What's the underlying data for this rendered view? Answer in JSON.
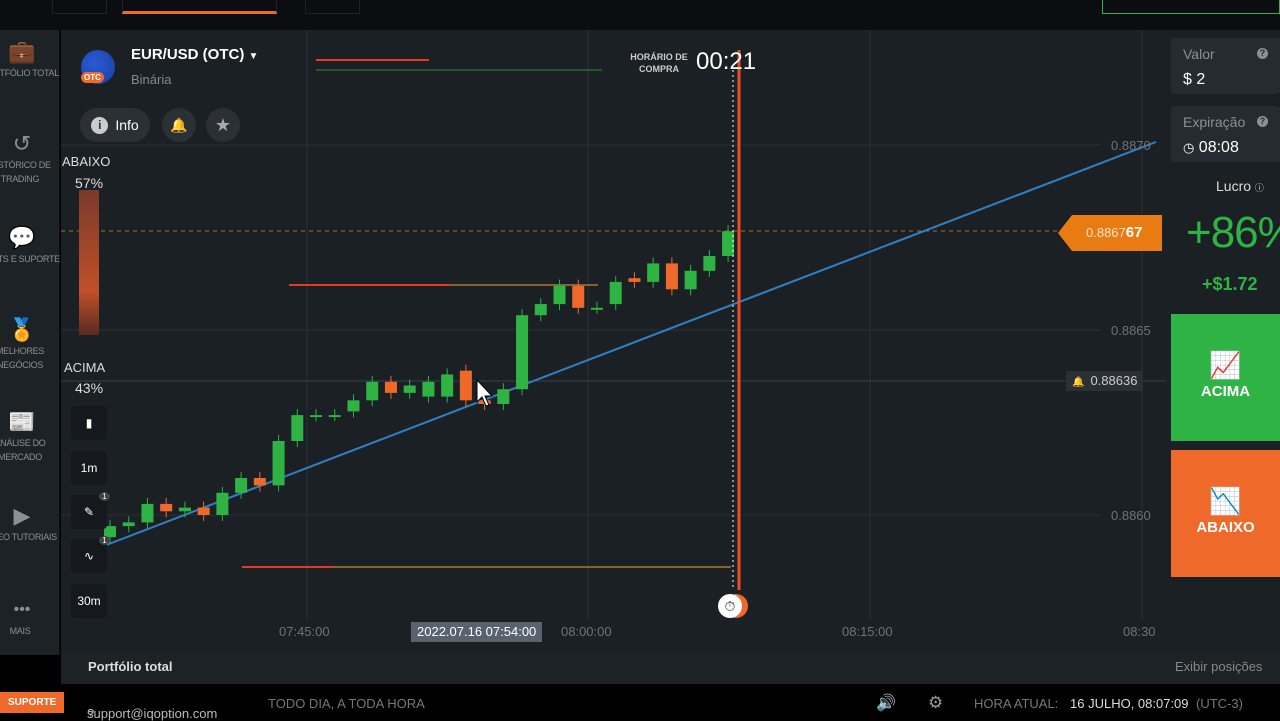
{
  "sidebar": {
    "items": [
      {
        "icon": "briefcase-icon",
        "glyph": "💼",
        "label": "Portfólio total"
      },
      {
        "icon": "history-icon",
        "glyph": "↺",
        "label": "Histórico de trading"
      },
      {
        "icon": "chat-icon",
        "glyph": "💬",
        "label": "Chats e suporte"
      },
      {
        "icon": "award-icon",
        "glyph": "🏅",
        "label": "Melhores negócios"
      },
      {
        "icon": "news-icon",
        "glyph": "📰",
        "label": "Análise do mercado"
      },
      {
        "icon": "play-icon",
        "glyph": "▶",
        "label": "Vídeo tutoriais"
      },
      {
        "icon": "more-icon",
        "glyph": "•••",
        "label": "Mais"
      }
    ]
  },
  "asset": {
    "name": "EUR/USD (OTC)",
    "type": "Binária",
    "badge": "OTC"
  },
  "toolbar": {
    "info": "Info"
  },
  "sentiment": {
    "down_label": "ABAIXO",
    "down_pct": "57%",
    "up_label": "ACIMA",
    "up_pct": "43%"
  },
  "timer": {
    "label": "HORÁRIO DE COMPRA",
    "value": "00:21"
  },
  "chart_tools": {
    "timeframe": "1m",
    "period": "30m",
    "badge1": "1",
    "badge2": "1"
  },
  "price_axis": [
    "0.8870",
    "0.8865",
    "0.8860"
  ],
  "time_axis": [
    "07:45:00",
    "08:00:00",
    "08:15:00",
    "08:30"
  ],
  "cursor_time": "2022.07.16 07:54:00",
  "current_price": {
    "main": "0.8867",
    "last": "67"
  },
  "alert_price": "0.88636",
  "colors": {
    "up": "#2fb344",
    "down": "#ef6a2a",
    "trend": "#2f7fc1",
    "accent": "#ef6a2a"
  },
  "candles": [
    [
      0.88594,
      0.88597
    ],
    [
      0.88597,
      0.88598
    ],
    [
      0.88598,
      0.88603
    ],
    [
      0.88603,
      0.88601
    ],
    [
      0.88601,
      0.88602
    ],
    [
      0.88602,
      0.886
    ],
    [
      0.886,
      0.88606
    ],
    [
      0.88606,
      0.8861
    ],
    [
      0.8861,
      0.88608
    ],
    [
      0.88608,
      0.8862
    ],
    [
      0.8862,
      0.88627
    ],
    [
      0.88627,
      0.88627
    ],
    [
      0.88627,
      0.88627
    ],
    [
      0.88628,
      0.88631
    ],
    [
      0.88631,
      0.88636
    ],
    [
      0.88636,
      0.88633
    ],
    [
      0.88633,
      0.88635
    ],
    [
      0.88632,
      0.88636
    ],
    [
      0.88632,
      0.88638
    ],
    [
      0.88639,
      0.88631
    ],
    [
      0.88631,
      0.8863
    ],
    [
      0.8863,
      0.88634
    ],
    [
      0.88634,
      0.88654
    ],
    [
      0.88654,
      0.88657
    ],
    [
      0.88657,
      0.88662
    ],
    [
      0.88662,
      0.88656
    ],
    [
      0.88656,
      0.88656
    ],
    [
      0.88657,
      0.88663
    ],
    [
      0.88664,
      0.88663
    ],
    [
      0.88663,
      0.88668
    ],
    [
      0.88668,
      0.88661
    ],
    [
      0.88661,
      0.88666
    ],
    [
      0.88666,
      0.8867
    ],
    [
      0.8867,
      0.886767
    ]
  ],
  "trade": {
    "value_label": "Valor",
    "value": "$ 2",
    "expiry_label": "Expiração",
    "expiry": "08:08",
    "profit_label": "Lucro",
    "profit_pct": "+86%",
    "profit_amt": "+$1.72",
    "up_btn": "ACIMA",
    "down_btn": "ABAIXO"
  },
  "bottom": {
    "portfolio": "Portfólio total",
    "show_positions": "Exibir posições"
  },
  "footer": {
    "support": "SUPORTE",
    "email": "support@iqoption.com",
    "hours": "TODO DIA, A TODA HORA",
    "time_label": "HORA ATUAL:",
    "time": "16 JULHO, 08:07:09",
    "tz": "(UTC-3)"
  }
}
